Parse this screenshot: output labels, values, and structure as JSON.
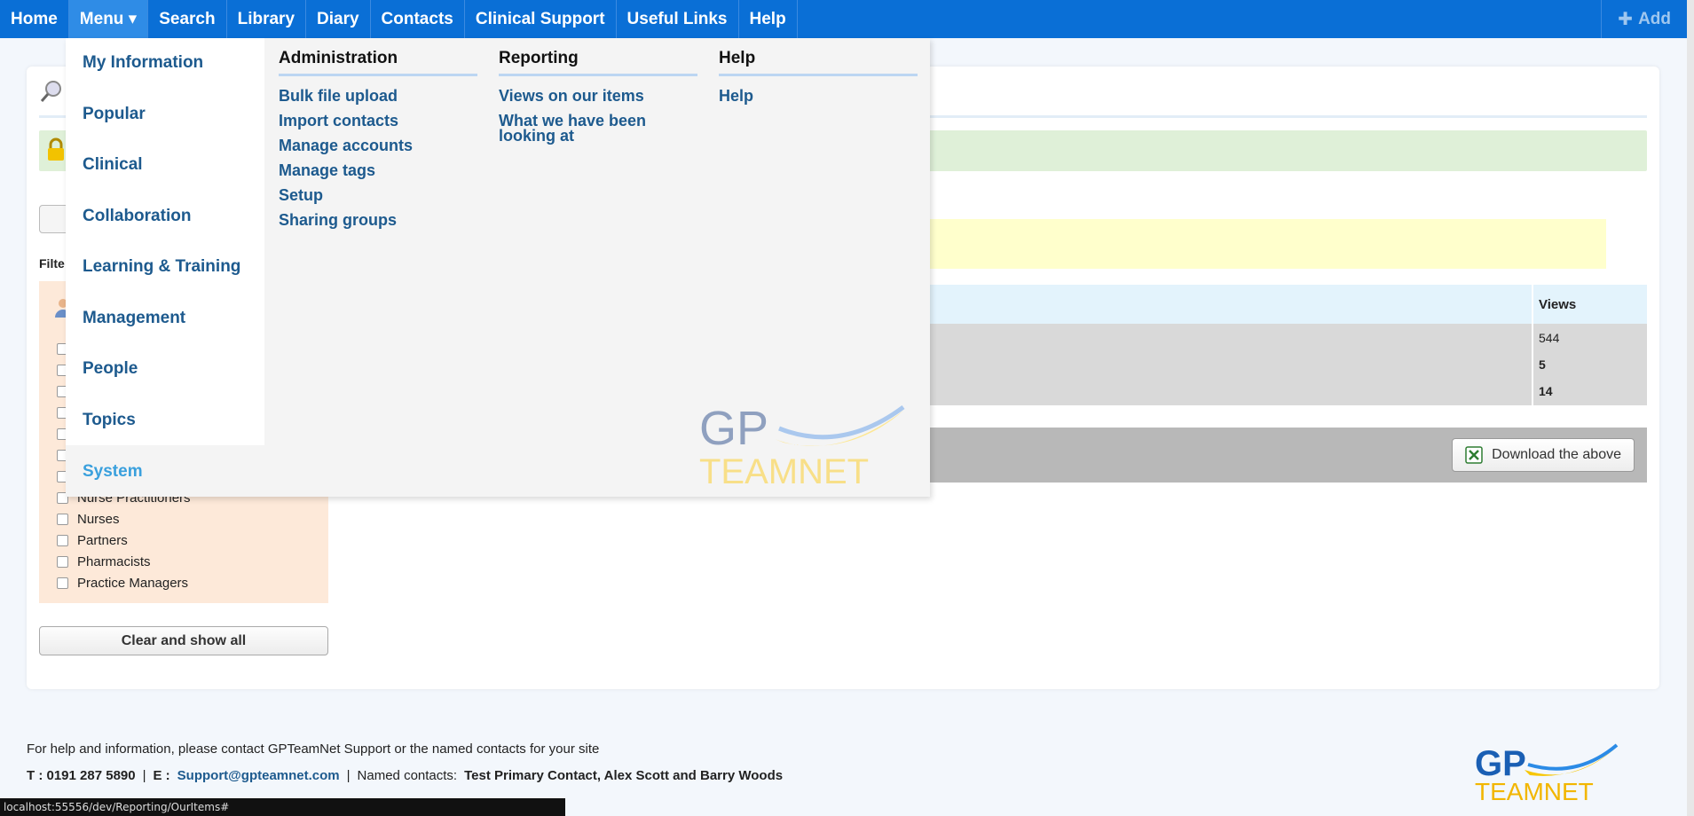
{
  "nav": {
    "items": [
      {
        "label": "Home"
      },
      {
        "label": "Menu ▾",
        "active": true
      },
      {
        "label": "Search"
      },
      {
        "label": "Library"
      },
      {
        "label": "Diary"
      },
      {
        "label": "Contacts"
      },
      {
        "label": "Clinical Support"
      },
      {
        "label": "Useful Links"
      },
      {
        "label": "Help"
      }
    ],
    "add_label": "Add",
    "add_icon": "plus-icon",
    "accent": "#0a6fd6"
  },
  "menu": {
    "left_items": [
      "My Information",
      "Popular",
      "Clinical",
      "Collaboration",
      "Learning & Training",
      "Management",
      "People",
      "Topics"
    ],
    "system_label": "System",
    "columns": [
      {
        "heading": "Administration",
        "links": [
          "Bulk file upload",
          "Import contacts",
          "Manage accounts",
          "Manage tags",
          "Setup",
          "Sharing groups"
        ]
      },
      {
        "heading": "Reporting",
        "links": [
          "Views on our items",
          "What we have been looking at"
        ]
      },
      {
        "heading": "Help",
        "links": [
          "Help"
        ]
      }
    ],
    "logo_gp": "GP",
    "logo_teamnet": "TEAMNET"
  },
  "page": {
    "filter_label": "Filte",
    "filters": [
      "Nurse Practitioners",
      "Nurses",
      "Partners",
      "Pharmacists",
      "Practice Managers"
    ],
    "clear_button": "Clear and show all",
    "views_header": "Views",
    "views_values": [
      "544",
      "5",
      "14"
    ],
    "download_button": "Download the above"
  },
  "footer": {
    "help_text": "For help and information, please contact GPTeamNet Support or the named contacts for your site",
    "phone": "T : 0191 287 5890",
    "email_label": "E :",
    "email": "Support@gpteamnet.com",
    "named_label": "Named contacts:",
    "named_contacts": "Test Primary Contact, Alex Scott and Barry Woods",
    "logo_gp": "GP",
    "logo_teamnet": "TEAMNET"
  },
  "status_url": "localhost:55556/dev/Reporting/OurItems#"
}
